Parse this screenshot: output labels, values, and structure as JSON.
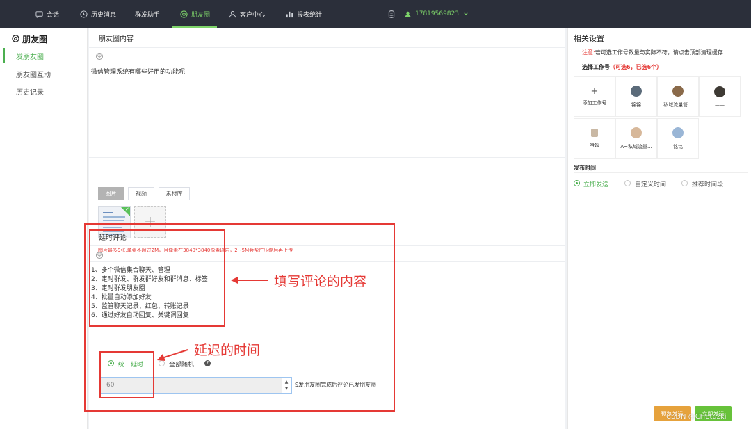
{
  "nav": {
    "items": [
      {
        "label": "会话",
        "icon": "chat-icon"
      },
      {
        "label": "历史消息",
        "icon": "clock-icon"
      },
      {
        "label": "群发助手",
        "icon": ""
      },
      {
        "label": "朋友圈",
        "icon": "moments-icon"
      },
      {
        "label": "客户中心",
        "icon": "user-icon"
      },
      {
        "label": "报表统计",
        "icon": "bar-chart-icon"
      }
    ],
    "active_index": 3,
    "phone": "17819569823",
    "accent": "#7ed46a"
  },
  "sidebar": {
    "title": "朋友圈",
    "items": [
      {
        "label": "发朋友圈",
        "active": true
      },
      {
        "label": "朋友圈互动",
        "active": false
      },
      {
        "label": "历史记录",
        "active": false
      }
    ]
  },
  "post": {
    "section_title": "朋友圈内容",
    "content": "微信管理系统有哪些好用的功能呢",
    "media_tabs": [
      "图片",
      "视频",
      "素材库"
    ],
    "active_tab": 0,
    "image_hint": "图片最多9张,单张不超过2M，且像素在3840*3840像素以内，2~5M会帮忙压缩后再上传"
  },
  "comment": {
    "section_title": "延时评论",
    "lines": [
      "1、多个微信集合聊天、管理",
      "2、定时群发、群发群好友和群消息、标签",
      "3、定时群发朋友圈",
      "4、批量自动添加好友",
      "5、监管聊天记录、红包、转账记录",
      "6、通过好友自动回复、关键词回复"
    ],
    "delay_options": [
      {
        "label": "统一延时",
        "checked": true
      },
      {
        "label": "全部随机",
        "checked": false
      }
    ],
    "delay_value": "60",
    "delay_suffix": "S发朋友圈完成后评论已发朋友圈"
  },
  "annotations": {
    "comment_note": "填写评论的内容",
    "delay_note": "延迟的时间"
  },
  "settings": {
    "title": "相关设置",
    "notice_label": "注意:",
    "notice_text": "若可选工作号数量与实际不符，请点击顶部清理缓存",
    "select_label": "选择工作号",
    "select_count": "（可选6，已选6个）",
    "add_label": "添加工作号",
    "accounts": [
      {
        "name": "锦锦",
        "color": "#5b6b7a"
      },
      {
        "name": "私域流量管...",
        "color": "#8a6a4a"
      },
      {
        "name": "——",
        "color": "#3e3a34"
      },
      {
        "name": "哈姆",
        "color": "#c9b8a4"
      },
      {
        "name": "A~私域流量...",
        "color": "#d7b89a"
      },
      {
        "name": "铭铭",
        "color": "#9ab6d6"
      }
    ],
    "publish_title": "发布时间",
    "publish_options": [
      {
        "label": "立即发送",
        "checked": true
      },
      {
        "label": "自定义时间",
        "checked": false
      },
      {
        "label": "推荐时间段",
        "checked": false
      }
    ],
    "preview_button": "预览发送",
    "send_button": "立即发送",
    "preview_color": "#e6a23c",
    "send_color": "#67c23a"
  },
  "watermark": "CSDN @CHEtuzki"
}
